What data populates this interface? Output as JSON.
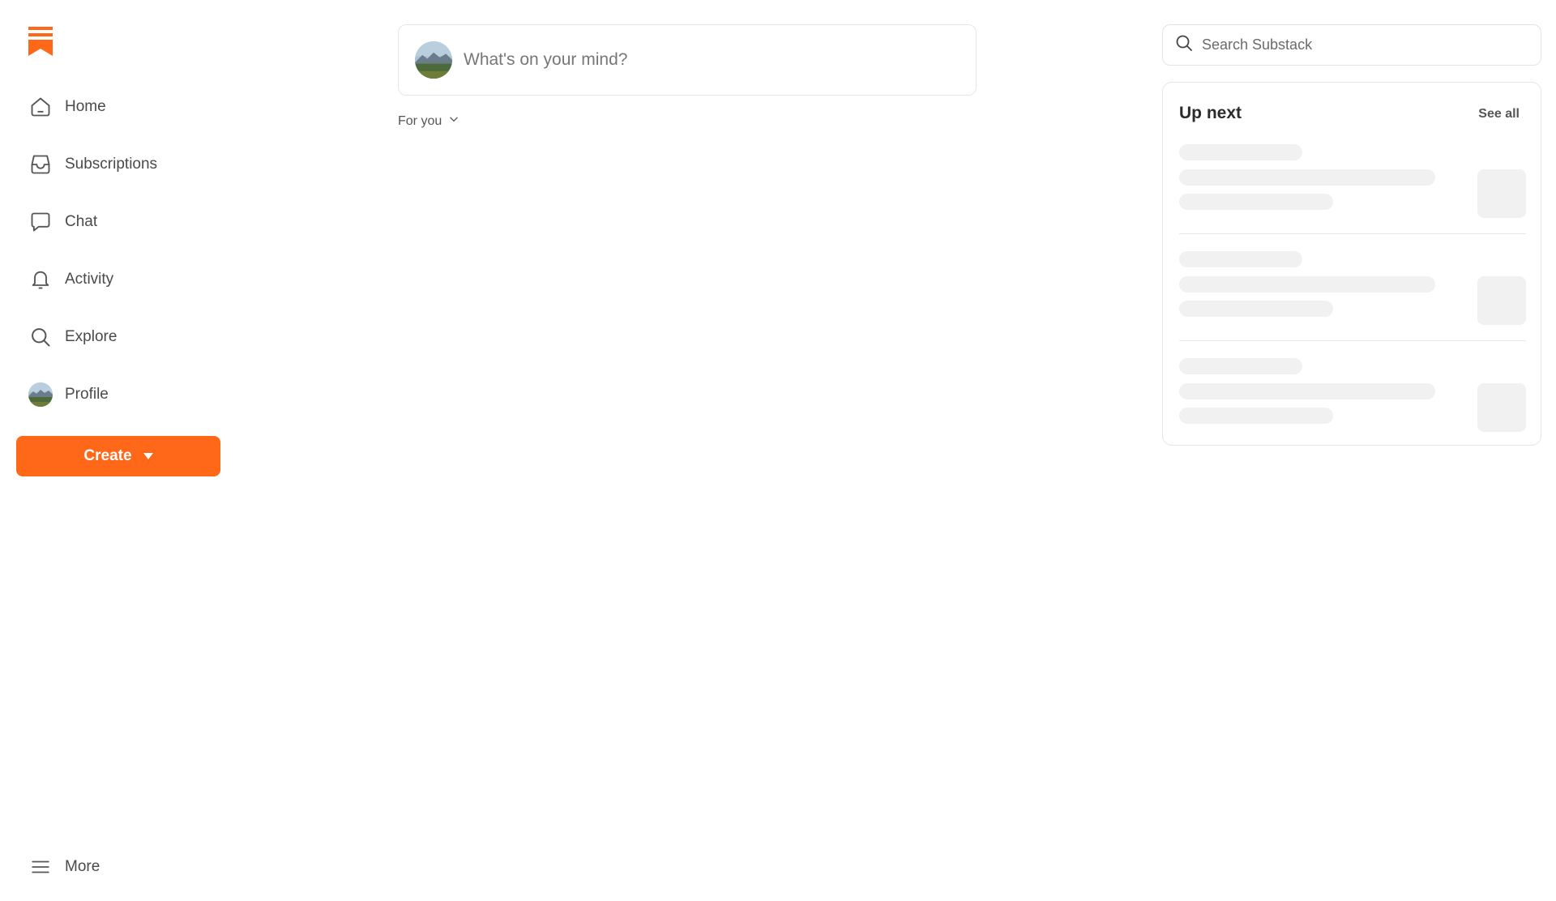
{
  "brand": {
    "accent": "#ff6719",
    "logo_icon": "substack-logo-icon"
  },
  "nav": {
    "items": [
      {
        "label": "Home",
        "icon": "home-icon"
      },
      {
        "label": "Subscriptions",
        "icon": "inbox-icon"
      },
      {
        "label": "Chat",
        "icon": "chat-bubble-icon"
      },
      {
        "label": "Activity",
        "icon": "bell-icon"
      },
      {
        "label": "Explore",
        "icon": "search-icon"
      },
      {
        "label": "Profile",
        "icon": "avatar"
      }
    ],
    "create_label": "Create",
    "more_label": "More"
  },
  "composer": {
    "placeholder": "What's on your mind?"
  },
  "feed": {
    "filter_label": "For you"
  },
  "search": {
    "placeholder": "Search Substack"
  },
  "upnext": {
    "title": "Up next",
    "see_all": "See all"
  }
}
